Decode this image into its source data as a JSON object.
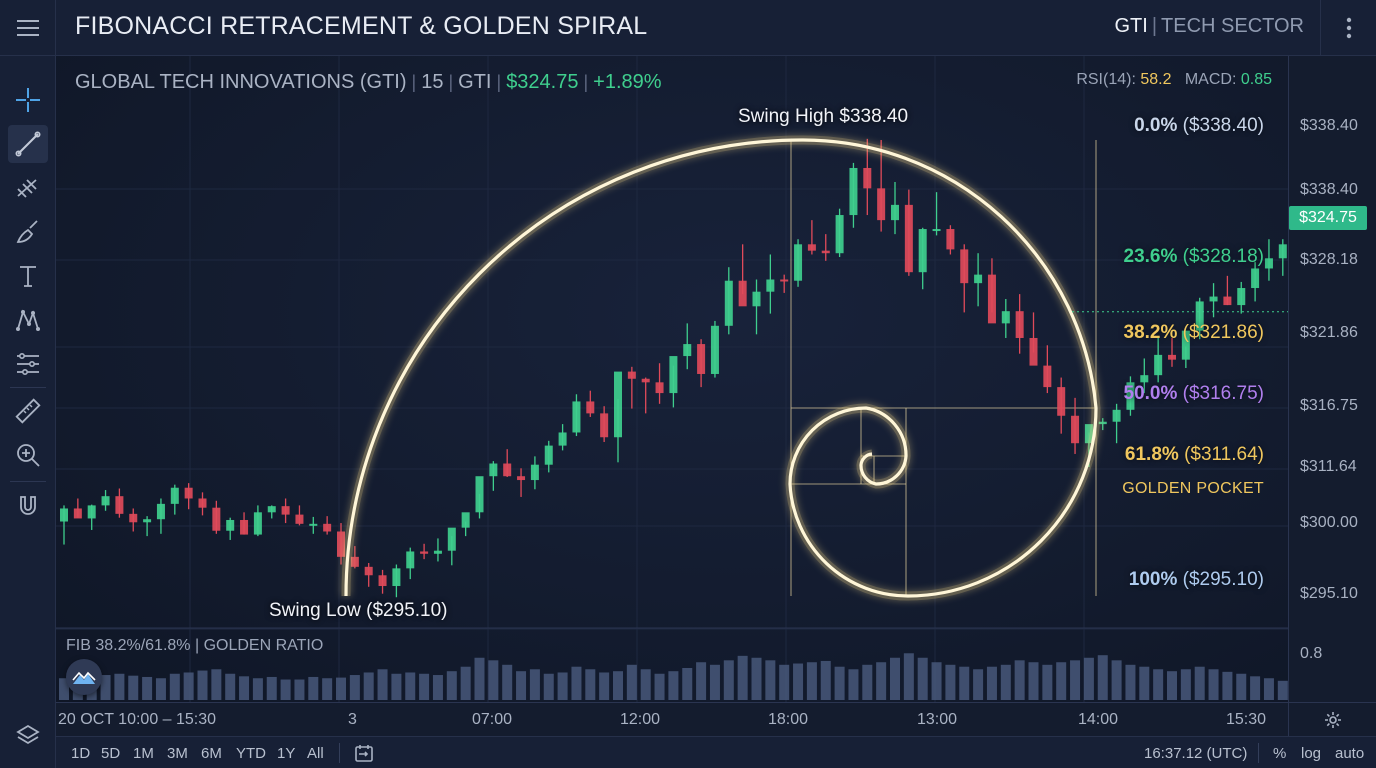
{
  "header": {
    "title": "FIBONACCI RETRACEMENT & GOLDEN SPIRAL",
    "symbol": "GTI",
    "sector": "TECH SECTOR"
  },
  "toolbar": {
    "tools": [
      "crosshair-icon",
      "trendline-icon",
      "fib-retracement-icon",
      "brush-icon",
      "text-icon",
      "pattern-icon",
      "fib-levels-icon",
      "ruler-icon",
      "zoom-icon",
      "magnet-icon",
      "layers-icon"
    ],
    "active": "trendline-icon"
  },
  "legend": {
    "name": "GLOBAL TECH INNOVATIONS (GTI)",
    "interval": "15",
    "exchange": "GTI",
    "price": "$324.75",
    "change": "+1.89%"
  },
  "indicators": {
    "rsi_label": "RSI(14):",
    "rsi_value": "58.2",
    "macd_label": "MACD:",
    "macd_value": "0.85"
  },
  "fib_levels": [
    {
      "pct": "0.0%",
      "price": "($338.40)",
      "color": "#aecbef",
      "value": 338.4
    },
    {
      "pct": "23.6%",
      "price": "($328.18)",
      "color": "#3fcf8e",
      "value": 328.18
    },
    {
      "pct": "38.2%",
      "price": "($321.86)",
      "color": "#f0c75e",
      "value": 321.86
    },
    {
      "pct": "50.0%",
      "price": "($316.75)",
      "color": "#a070e0",
      "value": 316.75
    },
    {
      "pct": "61.8%",
      "price": "($311.64)",
      "color": "#f0c75e",
      "value": 311.64
    },
    {
      "pct": "100%",
      "price": "($295.10)",
      "color": "#aecbef",
      "value": 295.1
    }
  ],
  "golden_pocket": "GOLDEN POCKET",
  "swing_high": "Swing High $338.40",
  "swing_low": "Swing Low ($295.10)",
  "volume_label": "FIB 38.2%/61.8% | GOLDEN RATIO",
  "price_axis": [
    "$338.40",
    "$338.40",
    "$328.18",
    "$321.86",
    "$316.75",
    "$311.64",
    "$300.00",
    "$295.10"
  ],
  "current_price": "$324.75",
  "volume_axis": "0.8",
  "time_axis": [
    "20 OCT  10:00  –  15:30",
    "3",
    "07:00",
    "12:00",
    "18:00",
    "13:00",
    "14:00",
    "15:30"
  ],
  "ranges": [
    "1D",
    "5D",
    "1M",
    "3M",
    "6M",
    "YTD",
    "1Y",
    "All"
  ],
  "clock": "16:37.12 (UTC)",
  "scale": [
    "%",
    "log",
    "auto"
  ],
  "colors": {
    "up": "#3fcf8e",
    "down": "#e04a5a",
    "spiral": "#fff6d8",
    "accent": "#2fb98a"
  },
  "chart_data": {
    "type": "candlestick",
    "y_levels": [
      338.4,
      328.18,
      321.86,
      316.75,
      311.64,
      295.1
    ],
    "candles": [
      [
        304.8,
        306.9,
        301.8,
        306.5
      ],
      [
        306.5,
        307.8,
        305.3,
        305.2
      ],
      [
        305.2,
        307.0,
        303.7,
        306.9
      ],
      [
        306.9,
        308.9,
        306.2,
        308.1
      ],
      [
        308.1,
        309.1,
        305.3,
        305.8
      ],
      [
        305.8,
        306.5,
        303.5,
        304.7
      ],
      [
        304.7,
        305.5,
        302.9,
        305.1
      ],
      [
        305.1,
        307.8,
        303.2,
        307.1
      ],
      [
        307.1,
        309.6,
        305.7,
        309.2
      ],
      [
        309.2,
        309.8,
        306.4,
        307.8
      ],
      [
        307.8,
        308.6,
        305.6,
        306.6
      ],
      [
        306.6,
        307.5,
        303.2,
        303.6
      ],
      [
        303.6,
        305.3,
        302.4,
        305.0
      ],
      [
        305.0,
        306.0,
        303.1,
        303.1
      ],
      [
        303.1,
        306.9,
        302.9,
        306.0
      ],
      [
        306.0,
        306.9,
        305.2,
        306.8
      ],
      [
        306.8,
        307.8,
        304.6,
        305.7
      ],
      [
        305.7,
        306.9,
        304.3,
        304.5
      ],
      [
        304.5,
        305.4,
        303.2,
        304.5
      ],
      [
        304.5,
        305.5,
        303.1,
        303.5
      ],
      [
        303.5,
        304.6,
        299.2,
        300.2
      ],
      [
        300.2,
        301.6,
        298.7,
        298.9
      ],
      [
        298.9,
        299.4,
        296.3,
        297.8
      ],
      [
        297.8,
        298.5,
        295.4,
        296.4
      ],
      [
        296.4,
        299.2,
        294.9,
        298.7
      ],
      [
        298.7,
        301.4,
        297.3,
        300.9
      ],
      [
        300.9,
        301.9,
        299.9,
        300.6
      ],
      [
        300.6,
        302.6,
        299.6,
        301.0
      ],
      [
        301.0,
        302.9,
        299.1,
        304.0
      ],
      [
        304.0,
        304.8,
        302.9,
        306.0
      ],
      [
        306.0,
        308.4,
        305.2,
        310.7
      ],
      [
        310.7,
        312.3,
        308.8,
        312.1
      ],
      [
        312.1,
        313.3,
        310.6,
        310.7
      ],
      [
        310.7,
        311.7,
        308.0,
        310.2
      ],
      [
        310.2,
        312.7,
        309.0,
        312.0
      ],
      [
        312.0,
        314.0,
        311.2,
        313.6
      ],
      [
        313.6,
        315.4,
        313.2,
        314.7
      ],
      [
        314.7,
        317.9,
        314.4,
        317.3
      ],
      [
        317.3,
        318.2,
        316.0,
        316.3
      ],
      [
        316.3,
        316.9,
        313.9,
        314.3
      ],
      [
        314.3,
        317.5,
        312.2,
        319.8
      ],
      [
        319.8,
        320.2,
        316.7,
        319.2
      ],
      [
        319.2,
        319.3,
        316.3,
        318.9
      ],
      [
        318.9,
        320.5,
        317.1,
        318.0
      ],
      [
        318.0,
        320.3,
        316.8,
        321.1
      ],
      [
        321.1,
        323.8,
        320.0,
        322.1
      ],
      [
        322.1,
        322.5,
        318.5,
        319.6
      ],
      [
        319.6,
        324.0,
        319.3,
        323.6
      ],
      [
        323.6,
        328.4,
        322.9,
        327.3
      ],
      [
        327.3,
        330.2,
        326.2,
        325.2
      ],
      [
        325.2,
        327.4,
        322.9,
        326.4
      ],
      [
        326.4,
        329.4,
        324.6,
        327.4
      ],
      [
        327.4,
        327.8,
        326.3,
        327.3
      ],
      [
        327.3,
        330.6,
        326.8,
        330.2
      ],
      [
        330.2,
        332.1,
        329.4,
        329.7
      ],
      [
        329.7,
        331.0,
        328.9,
        329.5
      ],
      [
        329.5,
        333.0,
        329.2,
        332.5
      ],
      [
        332.5,
        336.6,
        331.5,
        336.2
      ],
      [
        336.2,
        338.7,
        332.5,
        334.6
      ],
      [
        334.6,
        338.4,
        331.2,
        332.1
      ],
      [
        332.1,
        335.1,
        331.0,
        333.3
      ],
      [
        333.3,
        334.5,
        327.7,
        328.0
      ],
      [
        328.0,
        331.5,
        326.6,
        331.4
      ],
      [
        331.4,
        334.3,
        330.9,
        331.4
      ],
      [
        331.4,
        331.7,
        329.4,
        329.8
      ],
      [
        329.8,
        330.2,
        324.7,
        327.1
      ],
      [
        327.1,
        329.5,
        325.2,
        327.8
      ],
      [
        327.8,
        329.1,
        324.7,
        323.8
      ],
      [
        323.8,
        325.8,
        322.6,
        324.8
      ],
      [
        324.8,
        326.2,
        321.3,
        322.6
      ],
      [
        322.6,
        324.7,
        321.4,
        320.3
      ],
      [
        320.3,
        322.0,
        318.0,
        318.5
      ],
      [
        318.5,
        319.3,
        314.6,
        316.1
      ],
      [
        316.1,
        317.6,
        312.9,
        313.8
      ],
      [
        313.8,
        314.7,
        311.8,
        315.4
      ],
      [
        315.4,
        315.9,
        314.9,
        315.6
      ],
      [
        315.6,
        317.1,
        313.8,
        316.6
      ],
      [
        316.6,
        319.4,
        316.1,
        318.9
      ],
      [
        318.9,
        320.9,
        318.0,
        319.5
      ],
      [
        319.5,
        322.7,
        318.9,
        321.2
      ],
      [
        321.2,
        322.6,
        320.2,
        320.8
      ],
      [
        320.8,
        321.9,
        320.1,
        323.2
      ],
      [
        323.2,
        325.9,
        322.5,
        325.6
      ],
      [
        325.6,
        327.1,
        324.3,
        326.0
      ],
      [
        326.0,
        327.7,
        325.3,
        325.3
      ],
      [
        325.3,
        327.2,
        324.6,
        326.7
      ],
      [
        326.7,
        328.8,
        325.6,
        328.3
      ],
      [
        328.3,
        330.6,
        327.3,
        329.1
      ],
      [
        329.1,
        330.6,
        327.7,
        330.2
      ],
      [
        330.2,
        331.5,
        328.9,
        331.9
      ]
    ],
    "volume": [
      0.34,
      0.36,
      0.32,
      0.39,
      0.41,
      0.38,
      0.36,
      0.34,
      0.41,
      0.43,
      0.46,
      0.48,
      0.41,
      0.37,
      0.34,
      0.36,
      0.32,
      0.32,
      0.36,
      0.34,
      0.35,
      0.39,
      0.43,
      0.48,
      0.41,
      0.43,
      0.41,
      0.39,
      0.45,
      0.52,
      0.66,
      0.62,
      0.55,
      0.45,
      0.48,
      0.41,
      0.43,
      0.52,
      0.48,
      0.43,
      0.45,
      0.55,
      0.48,
      0.41,
      0.45,
      0.5,
      0.59,
      0.55,
      0.62,
      0.69,
      0.66,
      0.62,
      0.55,
      0.57,
      0.59,
      0.61,
      0.52,
      0.48,
      0.55,
      0.59,
      0.66,
      0.73,
      0.66,
      0.59,
      0.55,
      0.52,
      0.48,
      0.52,
      0.55,
      0.62,
      0.59,
      0.55,
      0.59,
      0.62,
      0.66,
      0.7,
      0.62,
      0.55,
      0.52,
      0.48,
      0.45,
      0.48,
      0.52,
      0.48,
      0.44,
      0.41,
      0.37,
      0.34,
      0.3,
      0.27
    ]
  }
}
